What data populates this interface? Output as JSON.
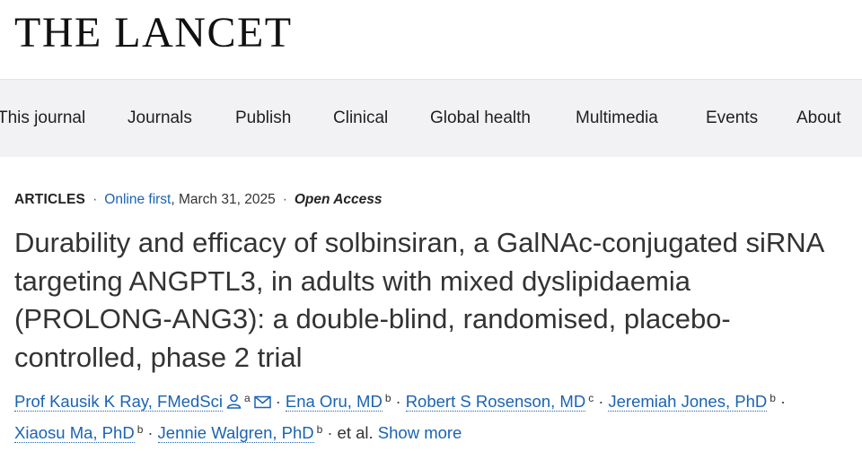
{
  "site": {
    "logo": "THE LANCET"
  },
  "nav": {
    "items": [
      {
        "label": "This journal"
      },
      {
        "label": "Journals"
      },
      {
        "label": "Publish"
      },
      {
        "label": "Clinical"
      },
      {
        "label": "Global health"
      },
      {
        "label": "Multimedia"
      },
      {
        "label": "Events"
      },
      {
        "label": "About"
      }
    ]
  },
  "article": {
    "type": "ARTICLES",
    "online_first": "Online first",
    "date": ", March 31, 2025",
    "access": "Open Access",
    "title": "Durability and efficacy of solbinsiran, a GalNAc-conjugated siRNA targeting ANGPTL3, in adults with mixed dyslipidaemia (PROLONG-ANG3): a double-blind, randomised, placebo-controlled, phase 2 trial",
    "authors": [
      {
        "name": "Prof Kausik K Ray, FMedSci",
        "sup": "a"
      },
      {
        "name": "Ena Oru, MD",
        "sup": "b"
      },
      {
        "name": "Robert S Rosenson, MD",
        "sup": "c"
      },
      {
        "name": "Jeremiah Jones, PhD",
        "sup": "b"
      },
      {
        "name": "Xiaosu Ma, PhD",
        "sup": "b"
      },
      {
        "name": "Jennie Walgren, PhD",
        "sup": "b"
      }
    ],
    "et_al": "et al.",
    "show_more": "Show more",
    "icons": [
      "person-icon",
      "envelope-icon"
    ]
  },
  "colors": {
    "link": "#1b63b3",
    "nav_bg": "#f2f2f4",
    "title_text": "#333333"
  }
}
